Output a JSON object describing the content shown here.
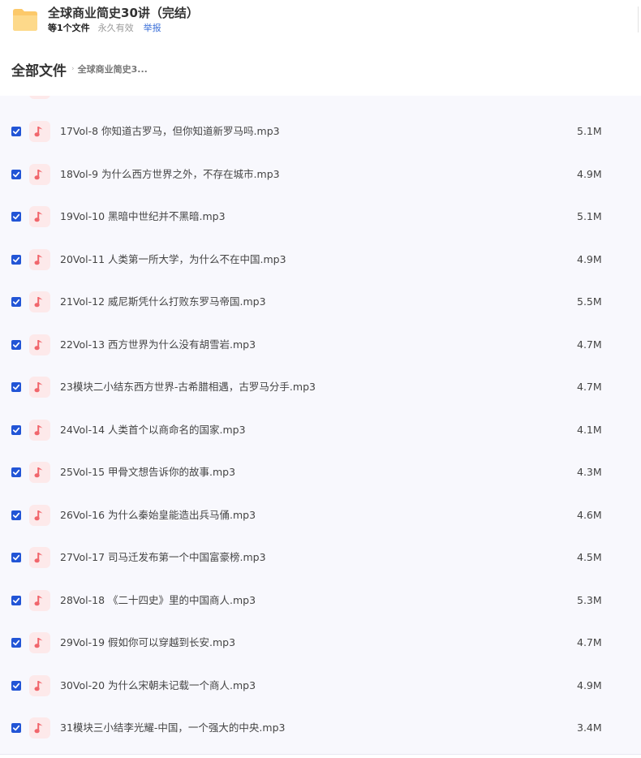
{
  "share": {
    "title": "全球商业简史30讲（完结）",
    "file_count": "等1个文件",
    "validity": "永久有效",
    "report_label": "举报"
  },
  "breadcrumb": {
    "root": "全部文件",
    "separator": "›",
    "current": "全球商业简史3..."
  },
  "icons": {
    "folder": "folder-icon",
    "music": "music-note-icon",
    "checkbox": "checkbox-checked-icon"
  },
  "colors": {
    "checkbox": "#2255d6",
    "music_badge_bg": "#fde9ea",
    "music_note": "#f1666c",
    "folder": "#fcc96a",
    "report_link": "#3a6fd8",
    "list_bg": "#f8f8fd"
  },
  "files": [
    {
      "name": "17Vol-8 你知道古罗马，但你知道新罗马吗.mp3",
      "size": "5.1M",
      "checked": true
    },
    {
      "name": "18Vol-9 为什么西方世界之外，不存在城市.mp3",
      "size": "4.9M",
      "checked": true
    },
    {
      "name": "19Vol-10 黑暗中世纪并不黑暗.mp3",
      "size": "5.1M",
      "checked": true
    },
    {
      "name": "20Vol-11 人类第一所大学，为什么不在中国.mp3",
      "size": "4.9M",
      "checked": true
    },
    {
      "name": "21Vol-12 威尼斯凭什么打败东罗马帝国.mp3",
      "size": "5.5M",
      "checked": true
    },
    {
      "name": "22Vol-13 西方世界为什么没有胡雪岩.mp3",
      "size": "4.7M",
      "checked": true
    },
    {
      "name": "23模块二小结东西方世界-古希腊相遇，古罗马分手.mp3",
      "size": "4.7M",
      "checked": true
    },
    {
      "name": "24Vol-14 人类首个以商命名的国家.mp3",
      "size": "4.1M",
      "checked": true
    },
    {
      "name": "25Vol-15 甲骨文想告诉你的故事.mp3",
      "size": "4.3M",
      "checked": true
    },
    {
      "name": "26Vol-16 为什么秦始皇能造出兵马俑.mp3",
      "size": "4.6M",
      "checked": true
    },
    {
      "name": "27Vol-17 司马迁发布第一个中国富豪榜.mp3",
      "size": "4.5M",
      "checked": true
    },
    {
      "name": "28Vol-18 《二十四史》里的中国商人.mp3",
      "size": "5.3M",
      "checked": true
    },
    {
      "name": "29Vol-19 假如你可以穿越到长安.mp3",
      "size": "4.7M",
      "checked": true
    },
    {
      "name": "30Vol-20 为什么宋朝未记载一个商人.mp3",
      "size": "4.9M",
      "checked": true
    },
    {
      "name": "31模块三小结李光耀-中国，一个强大的中央.mp3",
      "size": "3.4M",
      "checked": true
    }
  ]
}
